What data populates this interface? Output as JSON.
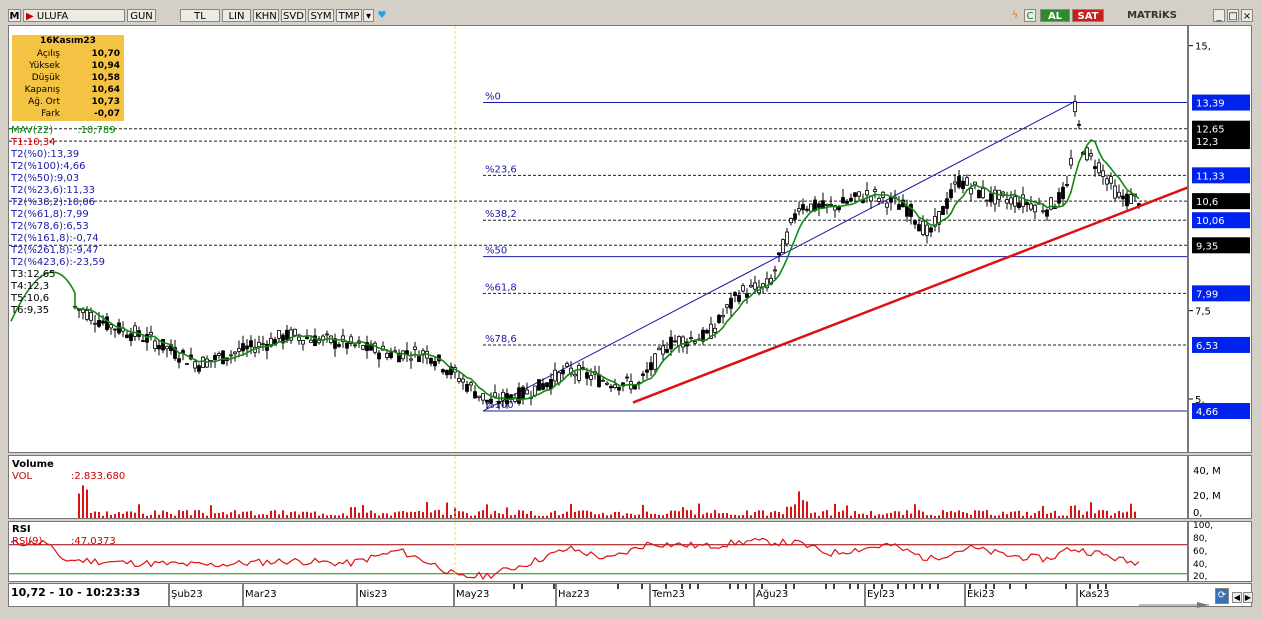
{
  "toolbar": {
    "symbol": "ULUFA",
    "buttons": [
      "GUN",
      "TL",
      "LIN",
      "KHN",
      "SVD",
      "SYM",
      "TMP"
    ],
    "al": "AL",
    "sat": "SAT",
    "brand": "MATRiKS"
  },
  "infobox": {
    "date": "16Kasım23",
    "rows": [
      {
        "label": "Açılış",
        "value": "10,70"
      },
      {
        "label": "Yüksek",
        "value": "10,94"
      },
      {
        "label": "Düşük",
        "value": "10,58"
      },
      {
        "label": "Kapanış",
        "value": "10,64"
      },
      {
        "label": "Ağ. Ort",
        "value": "10,73"
      },
      {
        "label": "Fark",
        "value": "-0,07"
      }
    ]
  },
  "legend": [
    {
      "text": "MAV(22)",
      "value": ":10,789",
      "color": "#008000"
    },
    {
      "text": "T1:10,34",
      "value": "",
      "color": "#cc0000"
    },
    {
      "text": "T2(%0):13,39",
      "value": "",
      "color": "#1a1aa6"
    },
    {
      "text": "T2(%100):4,66",
      "value": "",
      "color": "#1a1aa6"
    },
    {
      "text": "T2(%50):9,03",
      "value": "",
      "color": "#1a1aa6"
    },
    {
      "text": "T2(%23,6):11,33",
      "value": "",
      "color": "#1a1aa6"
    },
    {
      "text": "T2(%38,2):10,06",
      "value": "",
      "color": "#1a1aa6"
    },
    {
      "text": "T2(%61,8):7,99",
      "value": "",
      "color": "#1a1aa6"
    },
    {
      "text": "T2(%78,6):6,53",
      "value": "",
      "color": "#1a1aa6"
    },
    {
      "text": "T2(%161,8):-0,74",
      "value": "",
      "color": "#1a1aa6"
    },
    {
      "text": "T2(%261,8):-9,47",
      "value": "",
      "color": "#1a1aa6"
    },
    {
      "text": "T2(%423,6):-23,59",
      "value": "",
      "color": "#1a1aa6"
    },
    {
      "text": "T3:12,65",
      "value": "",
      "color": "#000000"
    },
    {
      "text": "T4:12,3",
      "value": "",
      "color": "#000000"
    },
    {
      "text": "T5:10,6",
      "value": "",
      "color": "#000000"
    },
    {
      "text": "T6:9,35",
      "value": "",
      "color": "#000000"
    }
  ],
  "fib_labels": [
    {
      "label": "%0",
      "value": 13.39
    },
    {
      "label": "%23,6",
      "value": 11.33
    },
    {
      "label": "%38,2",
      "value": 10.06
    },
    {
      "label": "%50",
      "value": 9.03
    },
    {
      "label": "%61,8",
      "value": 7.99
    },
    {
      "label": "%78,6",
      "value": 6.53
    },
    {
      "label": "%100",
      "value": 4.66
    }
  ],
  "price_tags": [
    {
      "text": "13,39",
      "value": 13.39,
      "style": "blue"
    },
    {
      "text": "12,65",
      "value": 12.65,
      "style": "black"
    },
    {
      "text": "12,3",
      "value": 12.3,
      "style": "black"
    },
    {
      "text": "11,33",
      "value": 11.33,
      "style": "blue"
    },
    {
      "text": "10,6",
      "value": 10.6,
      "style": "black"
    },
    {
      "text": "10,06",
      "value": 10.06,
      "style": "blue"
    },
    {
      "text": "9,35",
      "value": 9.35,
      "style": "black"
    },
    {
      "text": "7,99",
      "value": 7.99,
      "style": "blue"
    },
    {
      "text": "6,53",
      "value": 6.53,
      "style": "blue"
    },
    {
      "text": "4,66",
      "value": 4.66,
      "style": "blue"
    }
  ],
  "axis_ticks": [
    {
      "text": "15,",
      "value": 15
    },
    {
      "text": "7,5",
      "value": 7.5
    },
    {
      "text": "5,",
      "value": 5
    }
  ],
  "volume": {
    "title": "Volume",
    "label": "VOL",
    "value": ":2.833.680",
    "ticks": [
      "40, M",
      "20, M",
      "0,"
    ]
  },
  "rsi": {
    "title": "RSI",
    "label": "RSI(9)",
    "value": ":47,0373",
    "ticks": [
      "100,",
      "80,",
      "60,",
      "40,",
      "20,"
    ],
    "upper": 70,
    "lower": 30
  },
  "status": "10,72 - 10 - 10:23:33",
  "months": [
    "Şub23",
    "Mar23",
    "Nis23",
    "May23",
    "Haz23",
    "Tem23",
    "Ağu23",
    "Eyl23",
    "Eki23",
    "Kas23"
  ],
  "chart_data": {
    "type": "candlestick",
    "symbol": "ULUFA",
    "ylim": [
      3.5,
      15.5
    ],
    "indicators": [
      "MAV(22)",
      "Fibonacci retracement",
      "trend line",
      "Volume",
      "RSI(9)"
    ],
    "fib_levels": {
      "0": 13.39,
      "23.6": 11.33,
      "38.2": 10.06,
      "50": 9.03,
      "61.8": 7.99,
      "78.6": 6.53,
      "100": 4.66
    },
    "horizontal_lines": [
      12.65,
      12.3,
      10.6,
      9.35
    ],
    "trend_line": {
      "start": {
        "x": "2023-06-20",
        "y": 4.9
      },
      "end": {
        "x": "2023-11-30",
        "y": 11.0
      }
    },
    "price_series": [
      {
        "month": "Şub23",
        "approx": 7.5
      },
      {
        "month": "Mar23",
        "approx": 6.8
      },
      {
        "month": "Nis23",
        "approx": 6.4
      },
      {
        "month": "May23",
        "approx": 4.9
      },
      {
        "month": "Haz23",
        "approx": 5.7
      },
      {
        "month": "Tem23",
        "approx": 6.8
      },
      {
        "month": "Ağu23",
        "approx": 10.4
      },
      {
        "month": "Eyl23",
        "approx": 10.7
      },
      {
        "month": "Eki23",
        "approx": 10.5
      },
      {
        "month": "Kas23",
        "approx": 10.64
      }
    ],
    "last": {
      "date": "16Kasım23",
      "open": 10.7,
      "high": 10.94,
      "low": 10.58,
      "close": 10.64,
      "vwap": 10.73,
      "change": -0.07
    },
    "mav22": 10.789,
    "volume_last": 2833680,
    "rsi_last": 47.0373
  }
}
